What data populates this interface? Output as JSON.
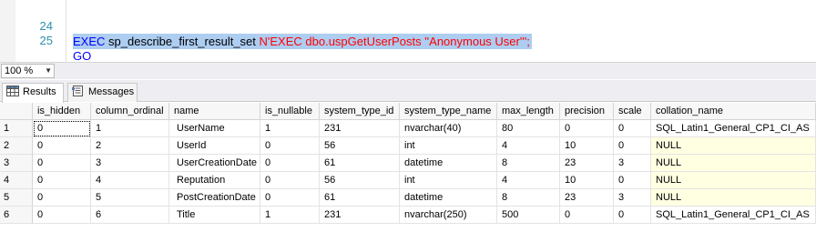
{
  "editor": {
    "lines": [
      {
        "number": "24",
        "keyword": "EXEC",
        "proc": "sp_describe_first_result_set",
        "string": "N'EXEC dbo.uspGetUserPosts ''Anonymous User''';"
      },
      {
        "number": "25",
        "keyword": "GO"
      }
    ],
    "colors": {
      "keyword": "#0000ff",
      "string": "#ff0000",
      "line_number": "#2b91af",
      "selection": "#adcdf1"
    }
  },
  "zoom": {
    "value": "100 %"
  },
  "tabs": [
    {
      "label": "Results",
      "icon": "grid-icon",
      "active": true
    },
    {
      "label": "Messages",
      "icon": "messages-icon",
      "active": false
    }
  ],
  "grid": {
    "columns": [
      "is_hidden",
      "column_ordinal",
      "name",
      "is_nullable",
      "system_type_id",
      "system_type_name",
      "max_length",
      "precision",
      "scale",
      "collation_name"
    ],
    "rows": [
      {
        "num": "1",
        "cells": [
          "0",
          "1",
          "UserName",
          "1",
          "231",
          "nvarchar(40)",
          "80",
          "0",
          "0",
          "SQL_Latin1_General_CP1_CI_AS"
        ]
      },
      {
        "num": "2",
        "cells": [
          "0",
          "2",
          "UserId",
          "0",
          "56",
          "int",
          "4",
          "10",
          "0",
          "NULL"
        ]
      },
      {
        "num": "3",
        "cells": [
          "0",
          "3",
          "UserCreationDate",
          "0",
          "61",
          "datetime",
          "8",
          "23",
          "3",
          "NULL"
        ]
      },
      {
        "num": "4",
        "cells": [
          "0",
          "4",
          "Reputation",
          "0",
          "56",
          "int",
          "4",
          "10",
          "0",
          "NULL"
        ]
      },
      {
        "num": "5",
        "cells": [
          "0",
          "5",
          "PostCreationDate",
          "0",
          "61",
          "datetime",
          "8",
          "23",
          "3",
          "NULL"
        ]
      },
      {
        "num": "6",
        "cells": [
          "0",
          "6",
          "Title",
          "1",
          "231",
          "nvarchar(250)",
          "500",
          "0",
          "0",
          "SQL_Latin1_General_CP1_CI_AS"
        ]
      }
    ],
    "colors": {
      "null_cell": "#ffffe1",
      "header": "#f7f7f7"
    }
  }
}
